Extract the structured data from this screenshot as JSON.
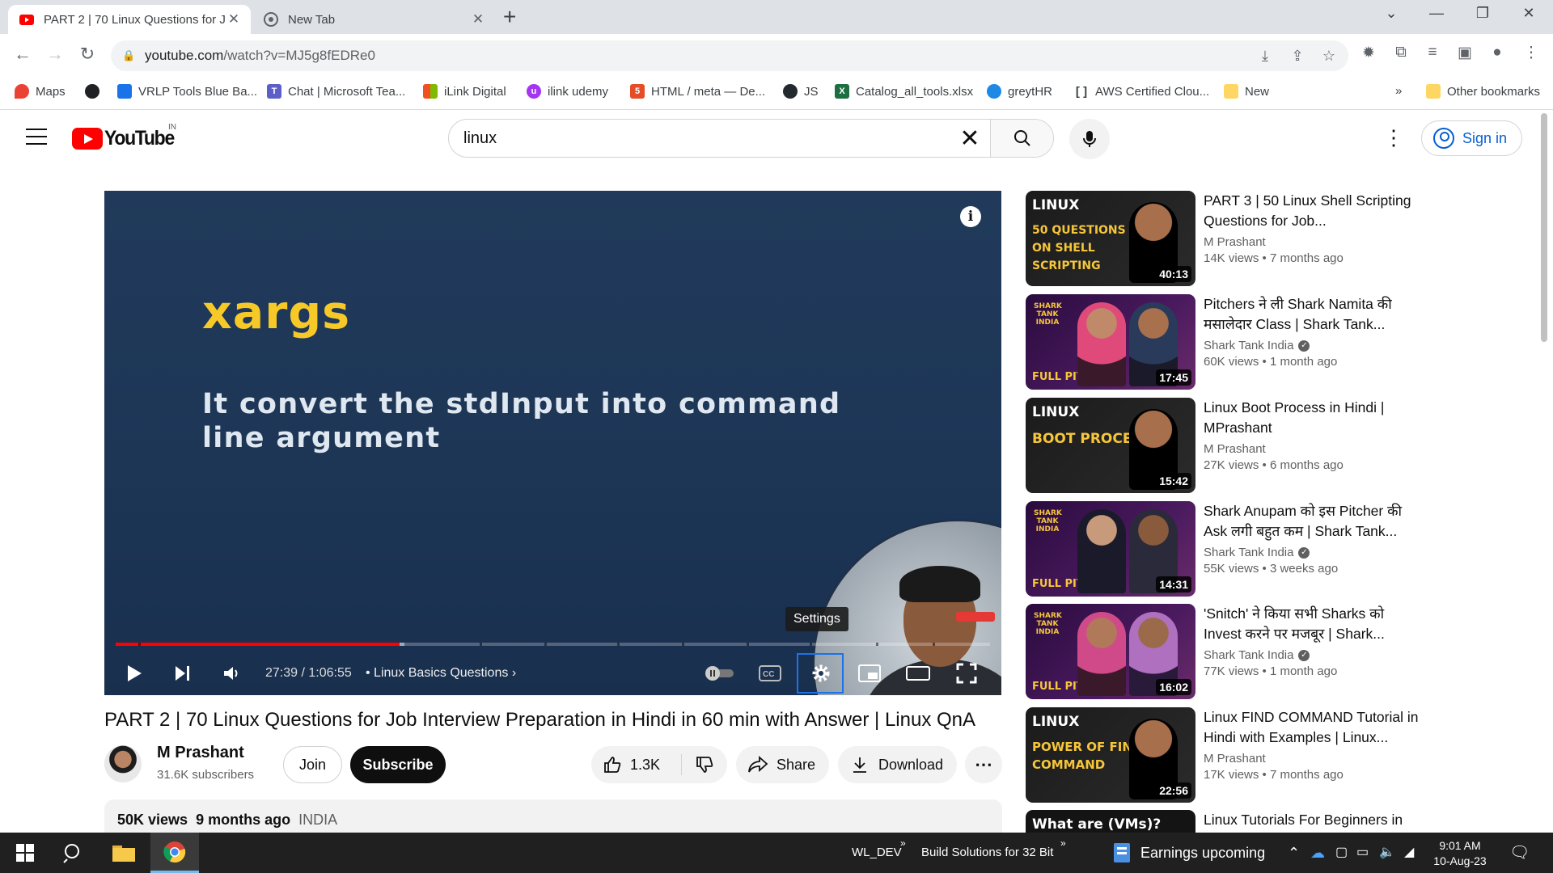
{
  "browser": {
    "tabs": [
      {
        "title": "PART 2 | 70 Linux Questions for J",
        "active": true
      },
      {
        "title": "New Tab",
        "active": false
      }
    ],
    "url": {
      "host": "youtube.com",
      "path": "/watch?v=MJ5g8fEDRe0"
    },
    "bookmarks": [
      {
        "label": "Maps",
        "icon": "maps-pin-icon",
        "color": "#ea4335"
      },
      {
        "label": "",
        "icon": "globe-icon",
        "color": "#202124"
      },
      {
        "label": "VRLP Tools Blue Ba...",
        "icon": "vrlp-icon",
        "color": "#1a73e8"
      },
      {
        "label": "Chat | Microsoft Tea...",
        "icon": "teams-icon",
        "color": "#5b5fc7"
      },
      {
        "label": "iLink Digital",
        "icon": "microsoft-icon",
        "color": "#f25022"
      },
      {
        "label": "ilink udemy",
        "icon": "udemy-icon",
        "color": "#a435f0"
      },
      {
        "label": "HTML / meta — De...",
        "icon": "html-icon",
        "color": "#e44d26"
      },
      {
        "label": "JS",
        "icon": "github-icon",
        "color": "#24292f"
      },
      {
        "label": "Catalog_all_tools.xlsx",
        "icon": "excel-icon",
        "color": "#1d6f42"
      },
      {
        "label": "greytHR",
        "icon": "greythr-icon",
        "color": "#1e88e5"
      },
      {
        "label": "AWS Certified Clou...",
        "icon": "bracket-icon",
        "color": "#3c4043"
      },
      {
        "label": "New",
        "icon": "folder-icon",
        "color": "#fdd663"
      }
    ],
    "bookmarks_overflow": "»",
    "other_bookmarks": "Other bookmarks"
  },
  "youtube": {
    "region": "IN",
    "search_query": "linux",
    "signin_label": "Sign in"
  },
  "player": {
    "slide_keyword": "xargs",
    "slide_text": "It convert the stdInput into command line argument",
    "tooltip": "Settings",
    "time": "27:39 / 1:06:55",
    "chapter": "• Linux Basics Questions",
    "progress_played": 0.325,
    "progress_loaded": 0.33
  },
  "video": {
    "title": "PART 2 | 70 Linux Questions for Job Interview Preparation in Hindi in 60 min with Answer | Linux QnA",
    "channel": "M Prashant",
    "subscribers": "31.6K subscribers",
    "join_label": "Join",
    "subscribe_label": "Subscribe",
    "likes": "1.3K",
    "share_label": "Share",
    "download_label": "Download",
    "views": "50K views",
    "age": "9 months ago",
    "country": "INDIA"
  },
  "recommendations": [
    {
      "title": "PART 3 | 50 Linux Shell Scripting Questions for Job...",
      "channel": "M Prashant",
      "verified": false,
      "stats": "14K views • 7 months ago",
      "duration": "40:13",
      "thumb_line1": "LINUX",
      "thumb_line2": "50 QUESTIONS ON SHELL SCRIPTING",
      "style": "linux"
    },
    {
      "title": "Pitchers ने ली Shark Namita की मसालेदार Class | Shark Tank...",
      "channel": "Shark Tank India",
      "verified": true,
      "stats": "60K views • 1 month ago",
      "duration": "17:45",
      "thumb_line1": "SHARK TANK INDIA",
      "thumb_line2": "FULL PITCH",
      "style": "shark"
    },
    {
      "title": "Linux Boot Process in Hindi | MPrashant",
      "channel": "M Prashant",
      "verified": false,
      "stats": "27K views • 6 months ago",
      "duration": "15:42",
      "thumb_line1": "LINUX",
      "thumb_line2": "BOOT PROCESS",
      "style": "linux"
    },
    {
      "title": "Shark Anupam को इस Pitcher की Ask लगी बहुत कम | Shark Tank...",
      "channel": "Shark Tank India",
      "verified": true,
      "stats": "55K views • 3 weeks ago",
      "duration": "14:31",
      "thumb_line1": "SHARK TANK INDIA",
      "thumb_line2": "FULL PITCH",
      "style": "shark"
    },
    {
      "title": "'Snitch' ने किया सभी Sharks को Invest करने पर मजबूर | Shark...",
      "channel": "Shark Tank India",
      "verified": true,
      "stats": "77K views • 1 month ago",
      "duration": "16:02",
      "thumb_line1": "SHARK TANK INDIA",
      "thumb_line2": "FULL PITCH",
      "style": "shark"
    },
    {
      "title": "Linux FIND COMMAND Tutorial in Hindi with Examples | Linux...",
      "channel": "M Prashant",
      "verified": false,
      "stats": "17K views • 7 months ago",
      "duration": "22:56",
      "thumb_line1": "LINUX",
      "thumb_line2": "POWER OF FIND COMMAND",
      "style": "linux"
    },
    {
      "title": "Linux Tutorials For Beginners in",
      "channel": "",
      "verified": false,
      "stats": "",
      "duration": "",
      "thumb_line1": "What are (VMs)?",
      "thumb_line2": "",
      "style": "dark"
    }
  ],
  "taskbar": {
    "labels": [
      "WL_DEV",
      "Build Solutions for 32 Bit",
      "Earnings upcoming"
    ],
    "time": "9:01 AM",
    "date": "10-Aug-23"
  }
}
